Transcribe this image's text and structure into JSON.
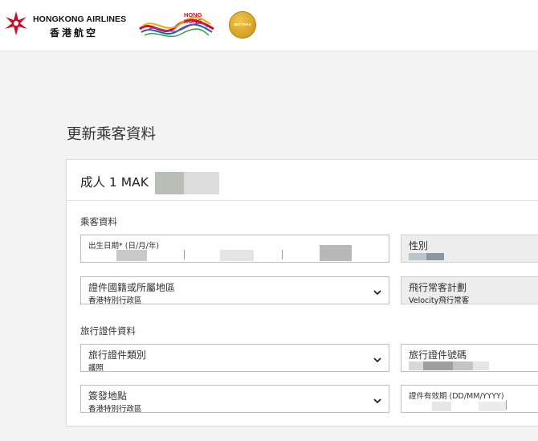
{
  "header": {
    "airline_name_en": "HONGKONG AIRLINES",
    "airline_name_zh": "香港航空",
    "hk_brand_logo_text": [
      "HONG",
      "KONG"
    ],
    "award_badge_text": "SKYTRAX"
  },
  "page": {
    "title": "更新乘客資料"
  },
  "passenger": {
    "label": "成人 1  MAK"
  },
  "passenger_info": {
    "section_title": "乘客資料",
    "dob": {
      "label": "出生日期* (日/月/年)"
    },
    "gender": {
      "label": "性別"
    },
    "nationality": {
      "label": "證件國籍或所屬地區",
      "value": "香港特別行政區"
    },
    "frequent_flyer": {
      "label": "飛行常客計劃",
      "value": "Velocity飛行常客"
    }
  },
  "travel_doc": {
    "section_title": "旅行證件資料",
    "doc_type": {
      "label": "旅行證件類別",
      "value": "護照"
    },
    "doc_number": {
      "label": "旅行證件號碼"
    },
    "issue_place": {
      "label": "簽發地點",
      "value": "香港特別行政區"
    },
    "expiry": {
      "label": "證件有效期 (DD/MM/YYYY)"
    }
  },
  "colors": {
    "brand_red": "#c8102e",
    "page_bg": "#f3f3f3",
    "readonly_field_bg": "#ededed"
  }
}
